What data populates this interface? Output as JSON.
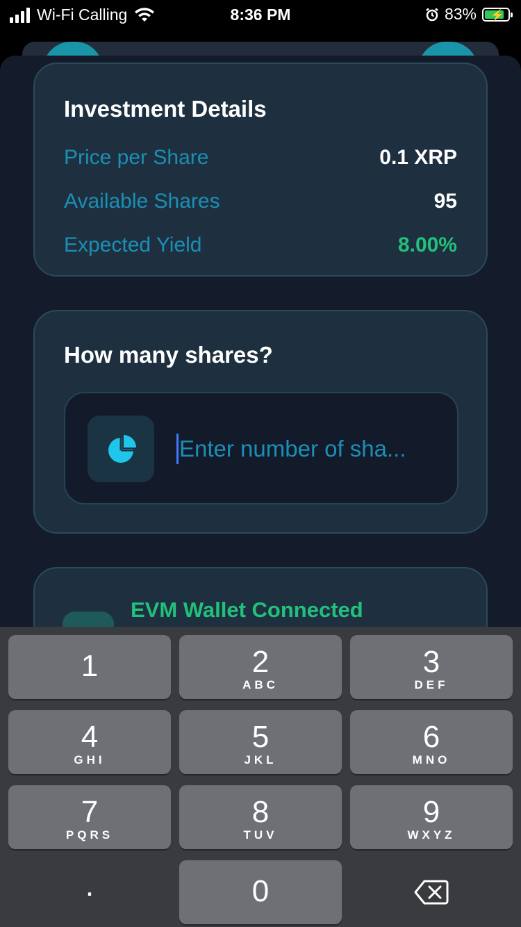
{
  "status_bar": {
    "carrier": "Wi-Fi Calling",
    "time": "8:36 PM",
    "battery_percent": "83%",
    "battery_level": 0.83
  },
  "investment": {
    "title": "Investment Details",
    "rows": [
      {
        "label": "Price per Share",
        "value": "0.1 XRP"
      },
      {
        "label": "Available Shares",
        "value": "95"
      },
      {
        "label": "Expected Yield",
        "value": "8.00%"
      }
    ]
  },
  "shares": {
    "title": "How many shares?",
    "placeholder": "Enter number of sha...",
    "icon": "pie-chart-icon"
  },
  "wallet": {
    "title": "EVM Wallet Connected"
  },
  "keypad": {
    "keys": [
      {
        "num": "1",
        "letters": ""
      },
      {
        "num": "2",
        "letters": "ABC"
      },
      {
        "num": "3",
        "letters": "DEF"
      },
      {
        "num": "4",
        "letters": "GHI"
      },
      {
        "num": "5",
        "letters": "JKL"
      },
      {
        "num": "6",
        "letters": "MNO"
      },
      {
        "num": "7",
        "letters": "PQRS"
      },
      {
        "num": "8",
        "letters": "TUV"
      },
      {
        "num": "9",
        "letters": "WXYZ"
      },
      {
        "num": ".",
        "letters": ""
      },
      {
        "num": "0",
        "letters": ""
      }
    ],
    "delete_icon": "backspace-icon"
  },
  "colors": {
    "accent": "#1b8fb5",
    "success": "#22c07a",
    "card_bg": "#1e3040",
    "sheet_bg": "#141b2a"
  }
}
